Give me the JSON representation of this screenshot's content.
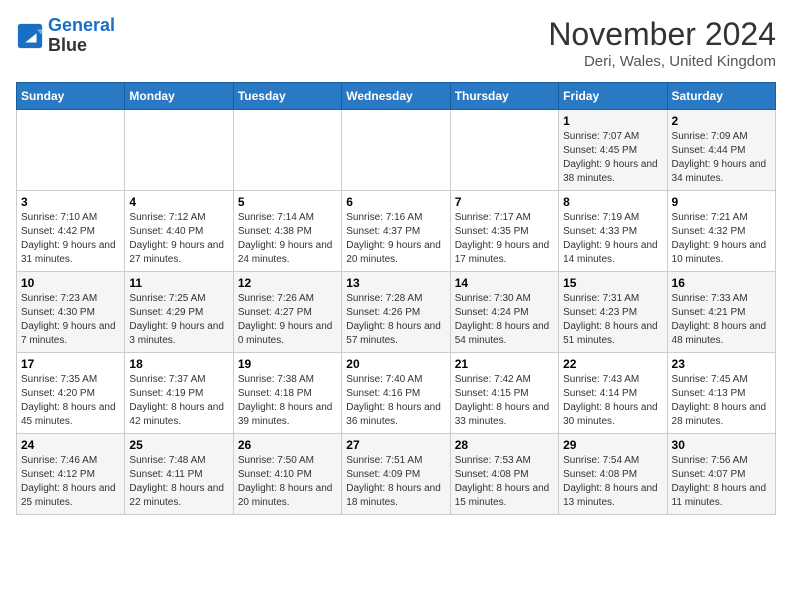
{
  "logo": {
    "line1": "General",
    "line2": "Blue"
  },
  "title": "November 2024",
  "subtitle": "Deri, Wales, United Kingdom",
  "days_of_week": [
    "Sunday",
    "Monday",
    "Tuesday",
    "Wednesday",
    "Thursday",
    "Friday",
    "Saturday"
  ],
  "weeks": [
    [
      {
        "day": "",
        "sunrise": "",
        "sunset": "",
        "daylight": ""
      },
      {
        "day": "",
        "sunrise": "",
        "sunset": "",
        "daylight": ""
      },
      {
        "day": "",
        "sunrise": "",
        "sunset": "",
        "daylight": ""
      },
      {
        "day": "",
        "sunrise": "",
        "sunset": "",
        "daylight": ""
      },
      {
        "day": "",
        "sunrise": "",
        "sunset": "",
        "daylight": ""
      },
      {
        "day": "1",
        "sunrise": "Sunrise: 7:07 AM",
        "sunset": "Sunset: 4:45 PM",
        "daylight": "Daylight: 9 hours and 38 minutes."
      },
      {
        "day": "2",
        "sunrise": "Sunrise: 7:09 AM",
        "sunset": "Sunset: 4:44 PM",
        "daylight": "Daylight: 9 hours and 34 minutes."
      }
    ],
    [
      {
        "day": "3",
        "sunrise": "Sunrise: 7:10 AM",
        "sunset": "Sunset: 4:42 PM",
        "daylight": "Daylight: 9 hours and 31 minutes."
      },
      {
        "day": "4",
        "sunrise": "Sunrise: 7:12 AM",
        "sunset": "Sunset: 4:40 PM",
        "daylight": "Daylight: 9 hours and 27 minutes."
      },
      {
        "day": "5",
        "sunrise": "Sunrise: 7:14 AM",
        "sunset": "Sunset: 4:38 PM",
        "daylight": "Daylight: 9 hours and 24 minutes."
      },
      {
        "day": "6",
        "sunrise": "Sunrise: 7:16 AM",
        "sunset": "Sunset: 4:37 PM",
        "daylight": "Daylight: 9 hours and 20 minutes."
      },
      {
        "day": "7",
        "sunrise": "Sunrise: 7:17 AM",
        "sunset": "Sunset: 4:35 PM",
        "daylight": "Daylight: 9 hours and 17 minutes."
      },
      {
        "day": "8",
        "sunrise": "Sunrise: 7:19 AM",
        "sunset": "Sunset: 4:33 PM",
        "daylight": "Daylight: 9 hours and 14 minutes."
      },
      {
        "day": "9",
        "sunrise": "Sunrise: 7:21 AM",
        "sunset": "Sunset: 4:32 PM",
        "daylight": "Daylight: 9 hours and 10 minutes."
      }
    ],
    [
      {
        "day": "10",
        "sunrise": "Sunrise: 7:23 AM",
        "sunset": "Sunset: 4:30 PM",
        "daylight": "Daylight: 9 hours and 7 minutes."
      },
      {
        "day": "11",
        "sunrise": "Sunrise: 7:25 AM",
        "sunset": "Sunset: 4:29 PM",
        "daylight": "Daylight: 9 hours and 3 minutes."
      },
      {
        "day": "12",
        "sunrise": "Sunrise: 7:26 AM",
        "sunset": "Sunset: 4:27 PM",
        "daylight": "Daylight: 9 hours and 0 minutes."
      },
      {
        "day": "13",
        "sunrise": "Sunrise: 7:28 AM",
        "sunset": "Sunset: 4:26 PM",
        "daylight": "Daylight: 8 hours and 57 minutes."
      },
      {
        "day": "14",
        "sunrise": "Sunrise: 7:30 AM",
        "sunset": "Sunset: 4:24 PM",
        "daylight": "Daylight: 8 hours and 54 minutes."
      },
      {
        "day": "15",
        "sunrise": "Sunrise: 7:31 AM",
        "sunset": "Sunset: 4:23 PM",
        "daylight": "Daylight: 8 hours and 51 minutes."
      },
      {
        "day": "16",
        "sunrise": "Sunrise: 7:33 AM",
        "sunset": "Sunset: 4:21 PM",
        "daylight": "Daylight: 8 hours and 48 minutes."
      }
    ],
    [
      {
        "day": "17",
        "sunrise": "Sunrise: 7:35 AM",
        "sunset": "Sunset: 4:20 PM",
        "daylight": "Daylight: 8 hours and 45 minutes."
      },
      {
        "day": "18",
        "sunrise": "Sunrise: 7:37 AM",
        "sunset": "Sunset: 4:19 PM",
        "daylight": "Daylight: 8 hours and 42 minutes."
      },
      {
        "day": "19",
        "sunrise": "Sunrise: 7:38 AM",
        "sunset": "Sunset: 4:18 PM",
        "daylight": "Daylight: 8 hours and 39 minutes."
      },
      {
        "day": "20",
        "sunrise": "Sunrise: 7:40 AM",
        "sunset": "Sunset: 4:16 PM",
        "daylight": "Daylight: 8 hours and 36 minutes."
      },
      {
        "day": "21",
        "sunrise": "Sunrise: 7:42 AM",
        "sunset": "Sunset: 4:15 PM",
        "daylight": "Daylight: 8 hours and 33 minutes."
      },
      {
        "day": "22",
        "sunrise": "Sunrise: 7:43 AM",
        "sunset": "Sunset: 4:14 PM",
        "daylight": "Daylight: 8 hours and 30 minutes."
      },
      {
        "day": "23",
        "sunrise": "Sunrise: 7:45 AM",
        "sunset": "Sunset: 4:13 PM",
        "daylight": "Daylight: 8 hours and 28 minutes."
      }
    ],
    [
      {
        "day": "24",
        "sunrise": "Sunrise: 7:46 AM",
        "sunset": "Sunset: 4:12 PM",
        "daylight": "Daylight: 8 hours and 25 minutes."
      },
      {
        "day": "25",
        "sunrise": "Sunrise: 7:48 AM",
        "sunset": "Sunset: 4:11 PM",
        "daylight": "Daylight: 8 hours and 22 minutes."
      },
      {
        "day": "26",
        "sunrise": "Sunrise: 7:50 AM",
        "sunset": "Sunset: 4:10 PM",
        "daylight": "Daylight: 8 hours and 20 minutes."
      },
      {
        "day": "27",
        "sunrise": "Sunrise: 7:51 AM",
        "sunset": "Sunset: 4:09 PM",
        "daylight": "Daylight: 8 hours and 18 minutes."
      },
      {
        "day": "28",
        "sunrise": "Sunrise: 7:53 AM",
        "sunset": "Sunset: 4:08 PM",
        "daylight": "Daylight: 8 hours and 15 minutes."
      },
      {
        "day": "29",
        "sunrise": "Sunrise: 7:54 AM",
        "sunset": "Sunset: 4:08 PM",
        "daylight": "Daylight: 8 hours and 13 minutes."
      },
      {
        "day": "30",
        "sunrise": "Sunrise: 7:56 AM",
        "sunset": "Sunset: 4:07 PM",
        "daylight": "Daylight: 8 hours and 11 minutes."
      }
    ]
  ]
}
